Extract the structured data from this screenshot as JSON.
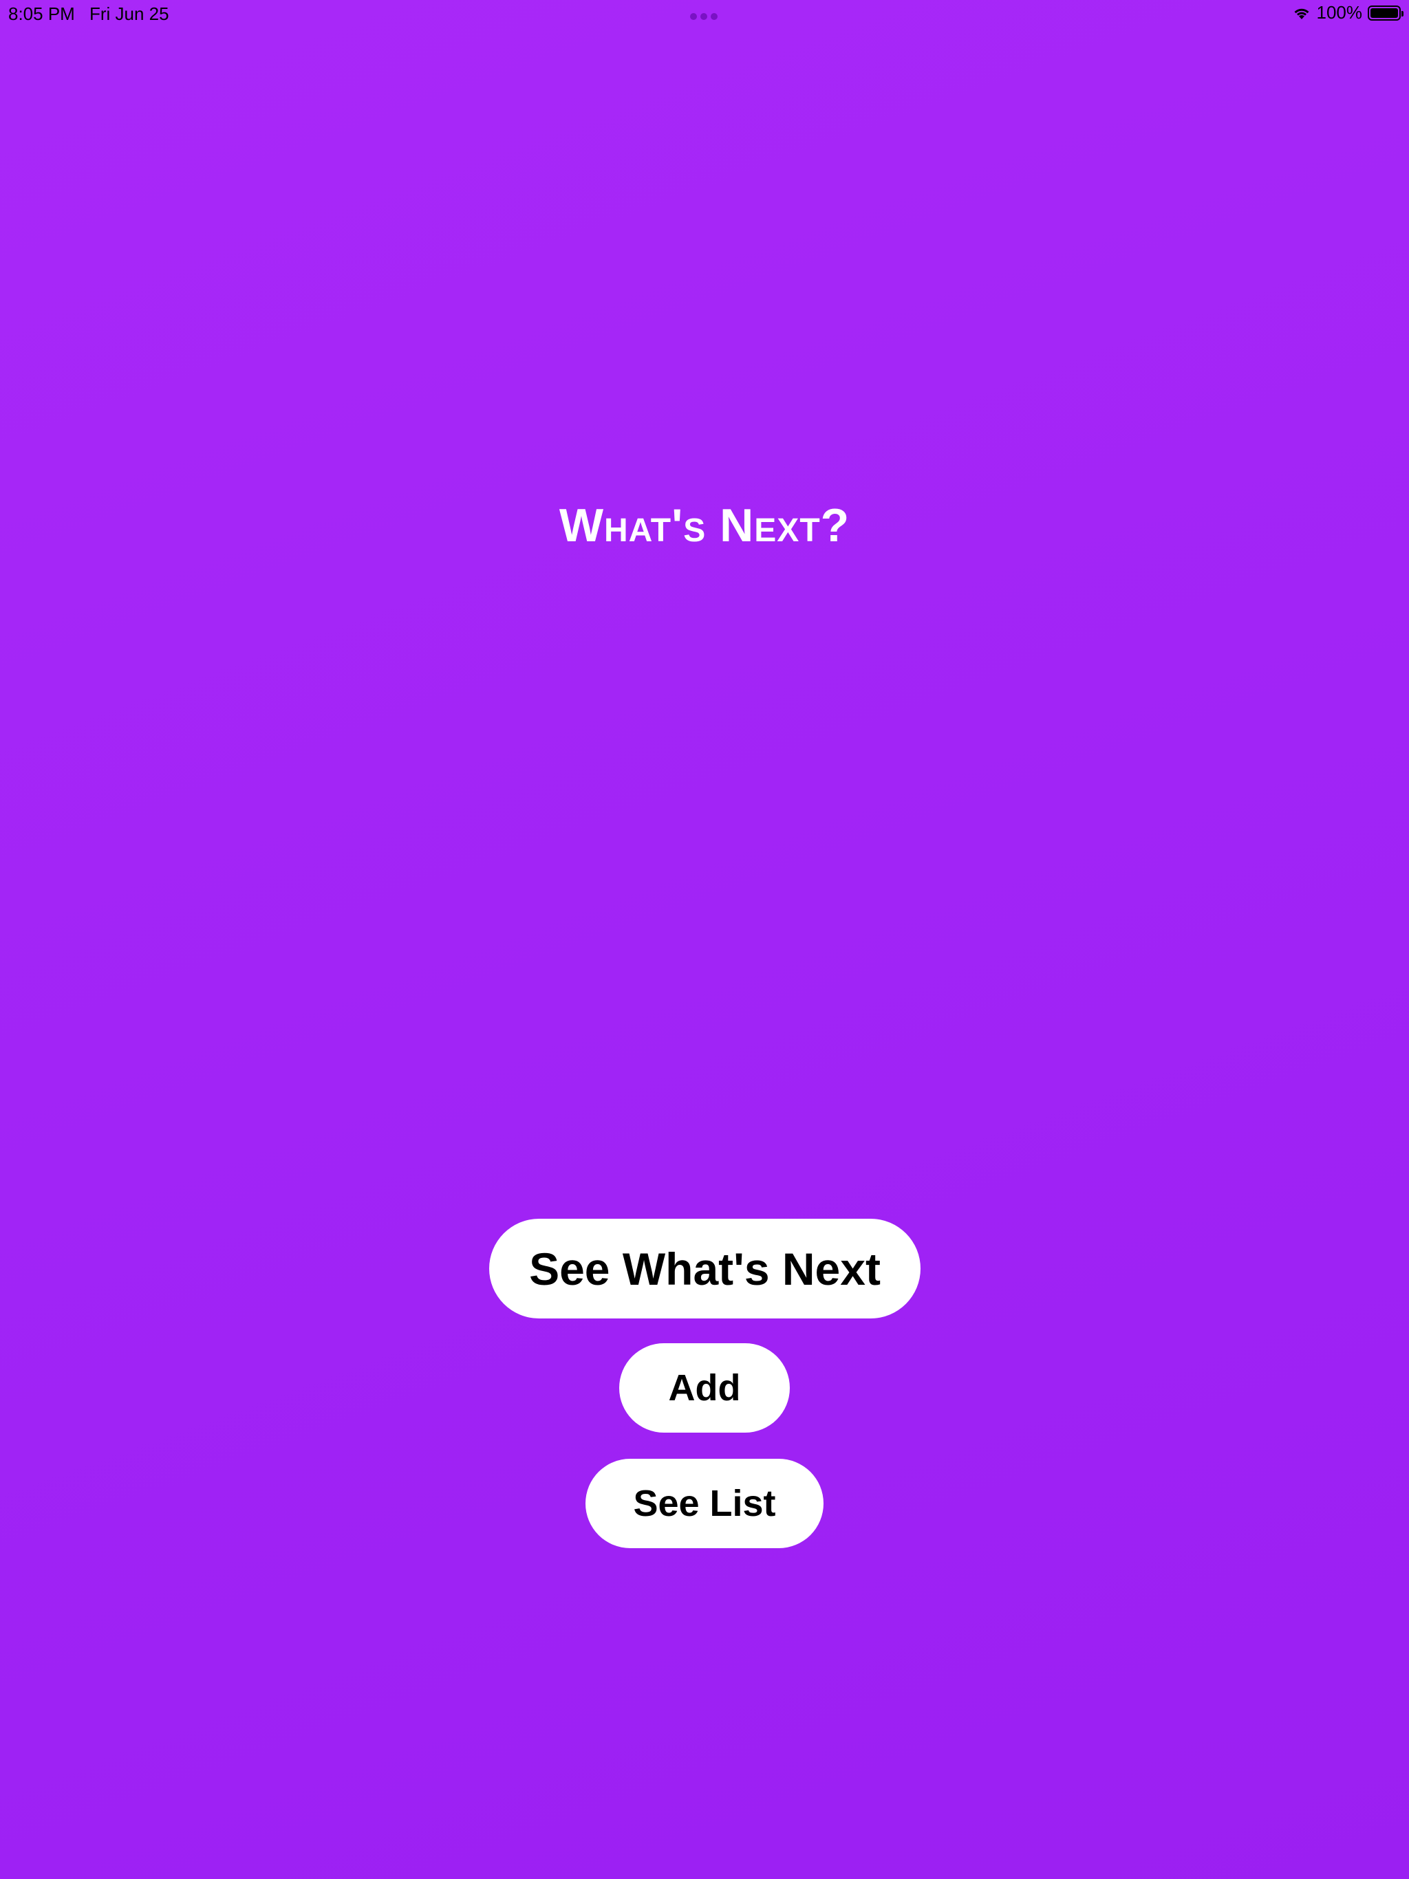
{
  "status_bar": {
    "time": "8:05 PM",
    "date": "Fri Jun 25",
    "battery": "100%",
    "battery_level": 1.0,
    "icons": [
      "wifi-icon",
      "battery-icon"
    ]
  },
  "title": "What's Next?",
  "buttons": {
    "see_whats_next": "See What's Next",
    "add": "Add",
    "see_list": "See List"
  },
  "colors": {
    "background": "#a124f6",
    "button_bg": "#ffffff",
    "button_text": "#000000",
    "title_text": "#ffffff"
  }
}
